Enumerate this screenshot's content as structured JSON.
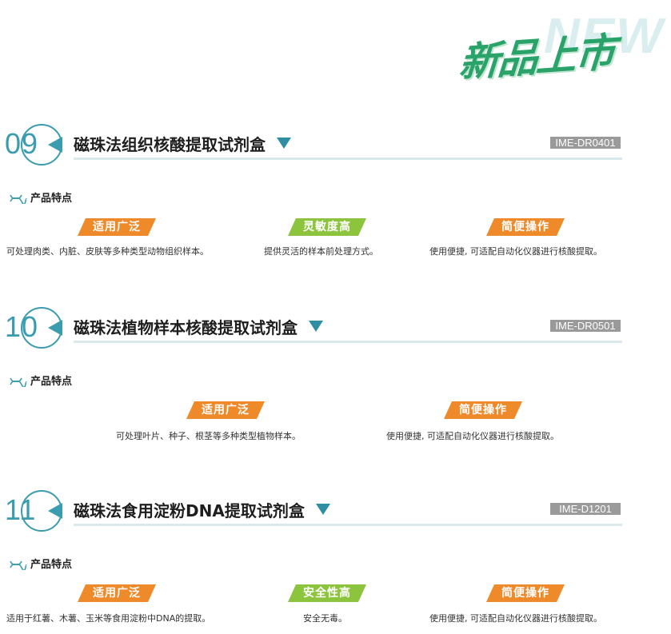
{
  "banner": {
    "new_text": "NEW",
    "xin_text": "新品上市"
  },
  "colors": {
    "accent": "#3a9cae",
    "orange": "#ef8a2b",
    "green": "#8cc43d",
    "code_bg": "#9a9a9a"
  },
  "sections": [
    {
      "number": "09",
      "title": "磁珠法组织核酸提取试剂盒",
      "code": "IME-DR0401",
      "features_label": "产品特点",
      "features": [
        {
          "tag": "适用广泛",
          "desc": "可处理肉类、内脏、皮肤等多种类型动物组织样本。"
        },
        {
          "tag": "灵敏度高",
          "desc": "提供灵活的样本前处理方式。"
        },
        {
          "tag": "简便操作",
          "desc": "使用便捷, 可适配自动化仪器进行核酸提取。"
        }
      ]
    },
    {
      "number": "10",
      "title": "磁珠法植物样本核酸提取试剂盒",
      "code": "IME-DR0501",
      "features_label": "产品特点",
      "features": [
        {
          "tag": "适用广泛",
          "desc": "可处理叶片、种子、根茎等多种类型植物样本。"
        },
        {
          "tag": "简便操作",
          "desc": "使用便捷, 可适配自动化仪器进行核酸提取。"
        }
      ]
    },
    {
      "number": "11",
      "title": "磁珠法食用淀粉DNA提取试剂盒",
      "code": "IME-D1201",
      "features_label": "产品特点",
      "features": [
        {
          "tag": "适用广泛",
          "desc": "适用于红薯、木薯、玉米等食用淀粉中DNA的提取。"
        },
        {
          "tag": "安全性高",
          "desc": "安全无毒。"
        },
        {
          "tag": "简便操作",
          "desc": "使用便捷, 可适配自动化仪器进行核酸提取。"
        }
      ]
    }
  ]
}
